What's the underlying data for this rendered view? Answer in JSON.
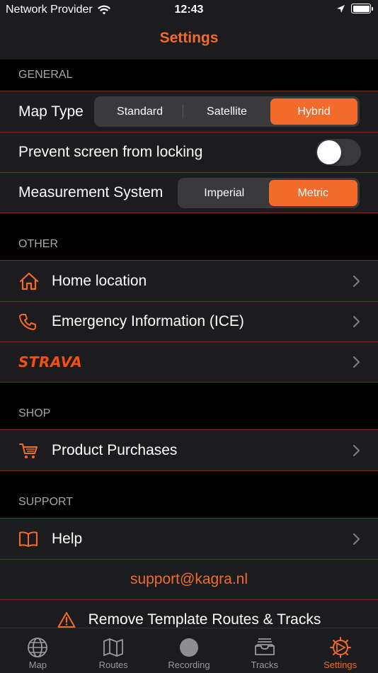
{
  "status_bar": {
    "carrier": "Network Provider",
    "time": "12:43"
  },
  "nav": {
    "title": "Settings"
  },
  "accent_color": "#f26b2a",
  "sections": {
    "general": {
      "header": "GENERAL",
      "map_type": {
        "label": "Map Type",
        "options": [
          "Standard",
          "Satellite",
          "Hybrid"
        ],
        "selected": "Hybrid"
      },
      "prevent_lock": {
        "label": "Prevent screen from locking",
        "enabled": false
      },
      "measurement": {
        "label": "Measurement System",
        "options": [
          "Imperial",
          "Metric"
        ],
        "selected": "Metric"
      }
    },
    "other": {
      "header": "OTHER",
      "home": {
        "label": "Home location",
        "icon": "home-icon"
      },
      "emergency": {
        "label": "Emergency Information (ICE)",
        "icon": "phone-icon"
      },
      "strava": {
        "label": "STRAVA"
      }
    },
    "shop": {
      "header": "SHOP",
      "purchases": {
        "label": "Product Purchases",
        "icon": "cart-icon"
      }
    },
    "support": {
      "header": "SUPPORT",
      "help": {
        "label": "Help",
        "icon": "book-icon"
      },
      "email": "support@kagra.nl",
      "remove": {
        "label": "Remove Template Routes & Tracks",
        "icon": "warning-icon"
      }
    }
  },
  "tabs": [
    {
      "label": "Map",
      "icon": "globe-icon",
      "active": false
    },
    {
      "label": "Routes",
      "icon": "map-icon",
      "active": false
    },
    {
      "label": "Recording",
      "icon": "record-icon",
      "active": false
    },
    {
      "label": "Tracks",
      "icon": "tray-icon",
      "active": false
    },
    {
      "label": "Settings",
      "icon": "settings-icon",
      "active": true
    }
  ]
}
